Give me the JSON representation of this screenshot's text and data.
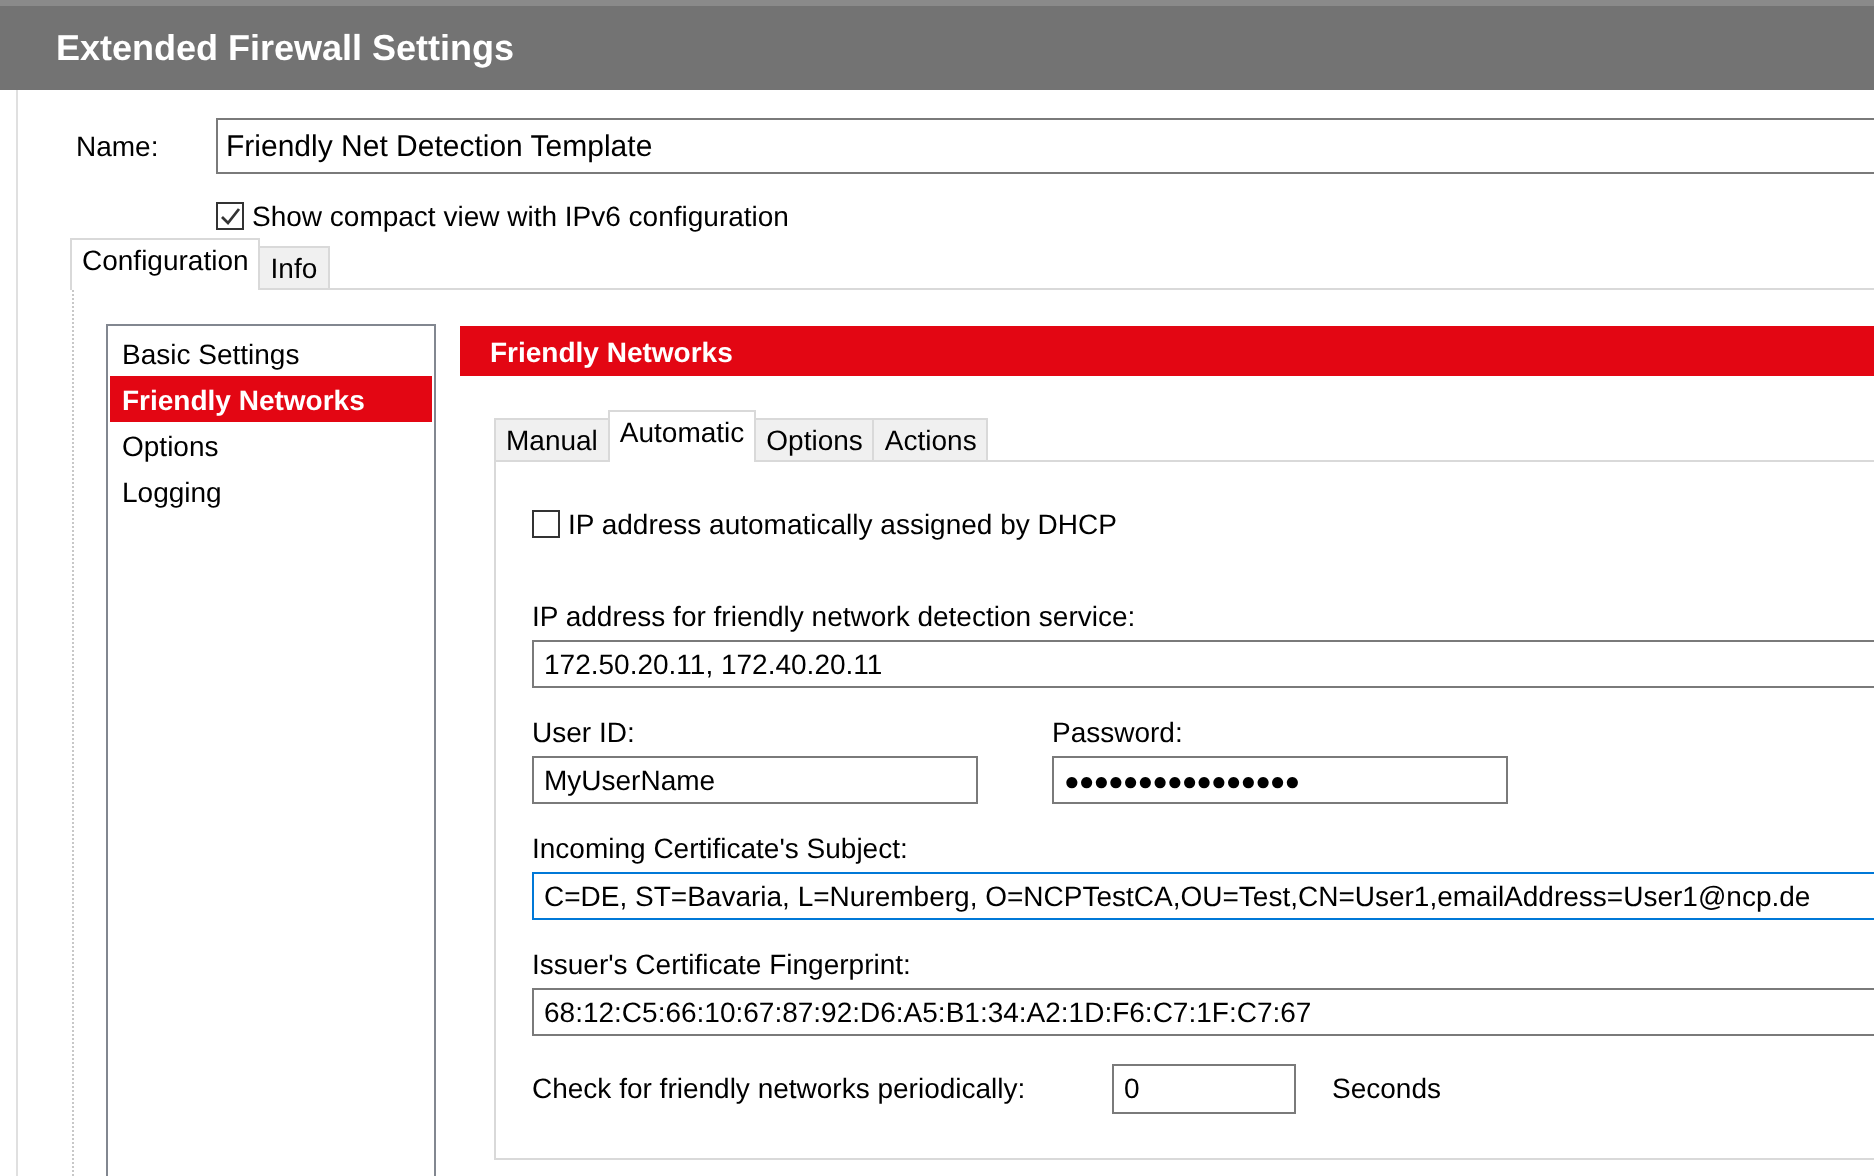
{
  "window": {
    "title": "Extended Firewall Settings"
  },
  "name_field": {
    "label": "Name:",
    "value": "Friendly Net Detection Template"
  },
  "compact_view": {
    "label": "Show compact view with IPv6 configuration",
    "checked": true
  },
  "tabs": [
    {
      "label": "Configuration",
      "selected": true
    },
    {
      "label": "Info",
      "selected": false
    }
  ],
  "sidebar": {
    "items": [
      {
        "label": "Basic Settings",
        "selected": false
      },
      {
        "label": "Friendly Networks",
        "selected": true
      },
      {
        "label": "Options",
        "selected": false
      },
      {
        "label": "Logging",
        "selected": false
      }
    ]
  },
  "section_title": "Friendly Networks",
  "sub_tabs": [
    {
      "label": "Manual",
      "selected": false
    },
    {
      "label": "Automatic",
      "selected": true
    },
    {
      "label": "Options",
      "selected": false
    },
    {
      "label": "Actions",
      "selected": false
    }
  ],
  "dhcp": {
    "label": "IP address automatically assigned by DHCP",
    "checked": false
  },
  "ip_address": {
    "label": "IP address for friendly network detection service:",
    "value": "172.50.20.11, 172.40.20.11",
    "focused": false
  },
  "user_id": {
    "label": "User ID:",
    "value": "MyUserName",
    "focused": false
  },
  "password": {
    "label": "Password:",
    "value": "●●●●●●●●●●●●●●●●",
    "focused": false
  },
  "certificate_subject": {
    "label": "Incoming Certificate's Subject:",
    "value": "C=DE, ST=Bavaria, L=Nuremberg, O=NCPTestCA,OU=Test,CN=User1,emailAddress=User1@ncp.de",
    "focused": true
  },
  "issuer_fingerprint": {
    "label": "Issuer's Certificate Fingerprint:",
    "value": "68:12:C5:66:10:67:87:92:D6:A5:B1:34:A2:1D:F6:C7:1F:C7:67",
    "focused": false
  },
  "check_period": {
    "label": "Check for friendly networks periodically:",
    "value": "0",
    "unit": "Seconds"
  }
}
